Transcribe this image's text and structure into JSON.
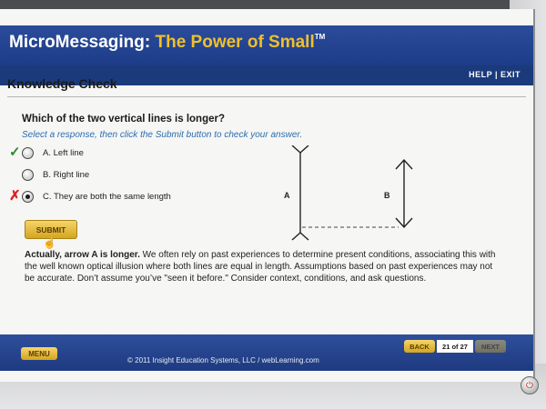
{
  "header": {
    "brand_main": "MicroMessaging:",
    "brand_tagline": "The Power of Small",
    "brand_tm": "TM",
    "help_exit": "HELP | EXIT"
  },
  "page": {
    "title": "Knowledge Check",
    "question": "Which of the two vertical lines is longer?",
    "instructions": "Select a response, then click the Submit button to check your answer."
  },
  "options": [
    {
      "label": "A. Left line",
      "selected": false,
      "mark": "check"
    },
    {
      "label": "B. Right line",
      "selected": false,
      "mark": ""
    },
    {
      "label": "C. They are both the same length",
      "selected": true,
      "mark": "x"
    }
  ],
  "marks": {
    "check": "✓",
    "x": "✗"
  },
  "submit_label": "SUBMIT",
  "feedback": {
    "lead": "Actually, arrow A is longer.",
    "body": " We often rely on past experiences to determine present conditions, associating this with the well known optical illusion where both lines are equal in length. Assumptions based on past experiences may not be accurate. Don’t assume you’ve \"seen it before.\" Consider context, conditions, and ask questions."
  },
  "illusion": {
    "label_a": "A",
    "label_b": "B"
  },
  "footer": {
    "menu_label": "MENU",
    "copyright": "© 2011 Insight Education Systems, LLC / webLearning.com",
    "back_label": "BACK",
    "page_count": "21 of 27",
    "next_label": "NEXT"
  },
  "icons": {
    "cursor": "hand-pointer-icon",
    "power": "power-icon"
  },
  "colors": {
    "header_blue": "#1d3c88",
    "accent_gold": "#f0c02a",
    "instruction_blue": "#2c6db0"
  }
}
